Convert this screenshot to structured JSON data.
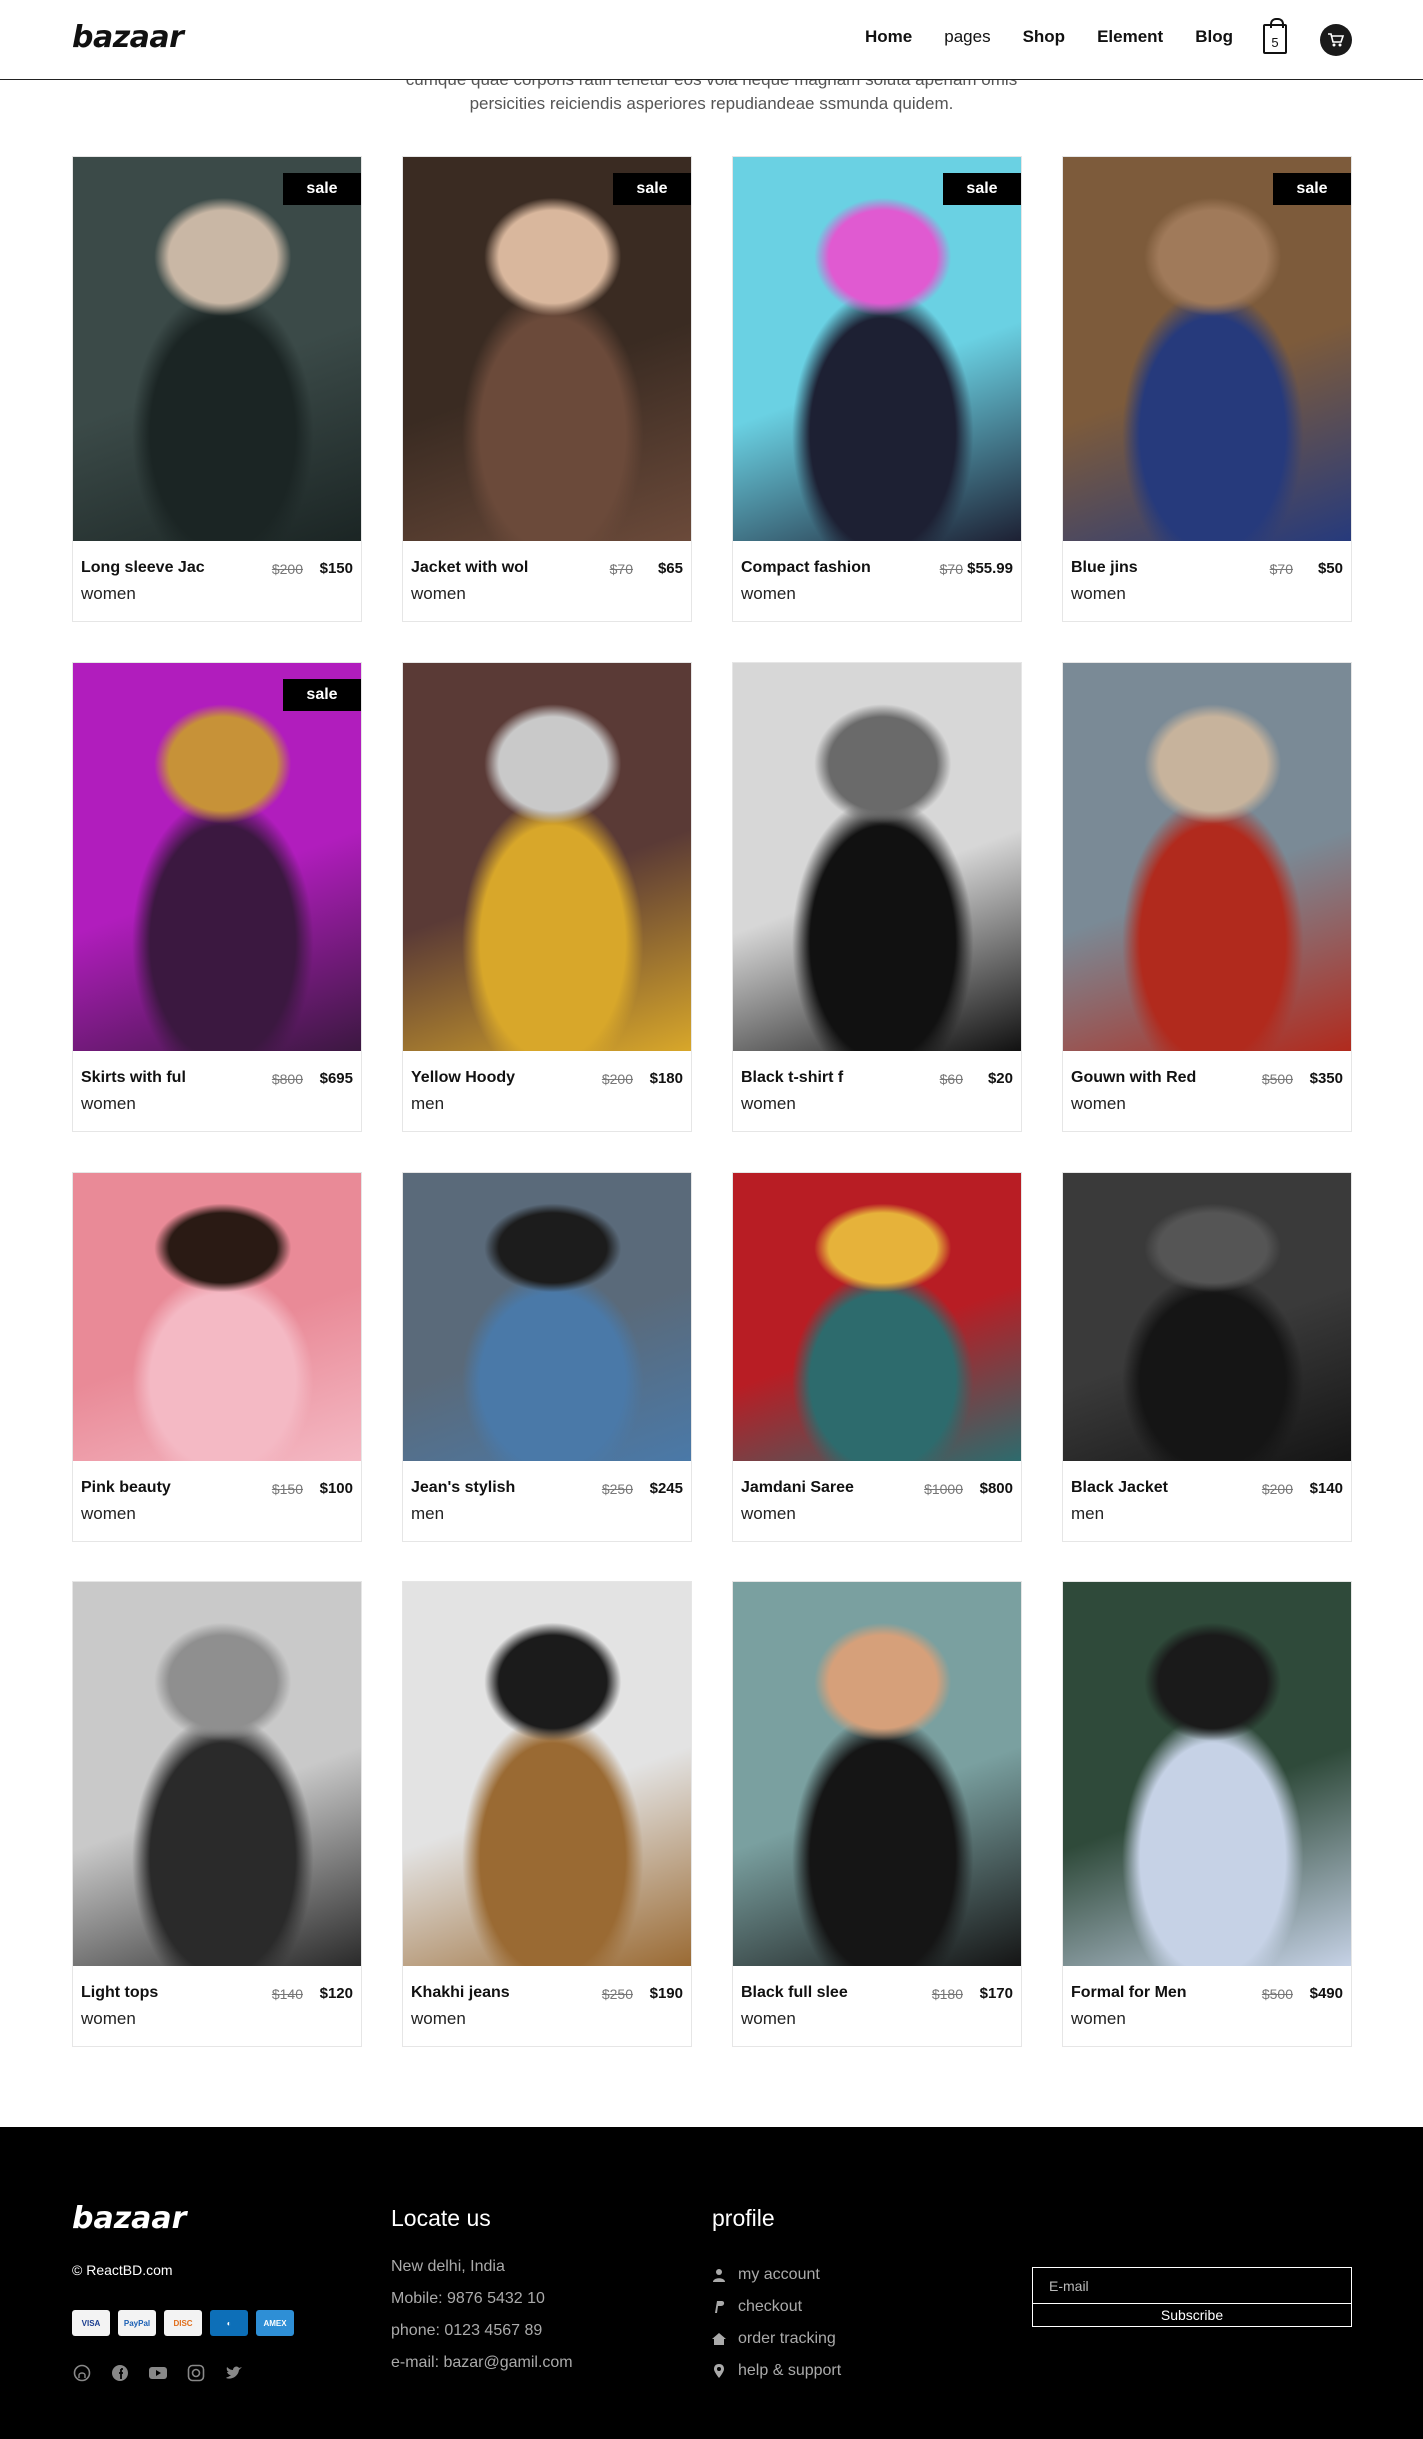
{
  "header": {
    "logo": "bazaar",
    "nav": [
      "Home",
      "pages",
      "Shop",
      "Element",
      "Blog"
    ],
    "bag_count": "5"
  },
  "intro": {
    "line1": "cumque quae corporis ratin tenetur eos vola neque magnam soluta aperiam omis",
    "line2": "persicities reiciendis asperiores repudiandeae ssmunda quidem."
  },
  "products": [
    {
      "name": "Long sleeve Jac",
      "old": "$200",
      "price": "$150",
      "category": "women",
      "sale": "sale",
      "colors": [
        "#3b4a48",
        "#1b2524",
        "#c9b7a5"
      ]
    },
    {
      "name": "Jacket with wol",
      "old": "$70",
      "price": "$65",
      "category": "women",
      "sale": "sale",
      "colors": [
        "#3a2b22",
        "#6b4a3a",
        "#d9b79d"
      ]
    },
    {
      "name": "Compact fashion",
      "old": "$70",
      "price": "$55.99",
      "category": "women",
      "sale": "sale",
      "colors": [
        "#6ad1e3",
        "#1d2033",
        "#e05ad1"
      ]
    },
    {
      "name": "Blue jins",
      "old": "$70",
      "price": "$50",
      "category": "women",
      "sale": "sale",
      "colors": [
        "#7d5b3b",
        "#263a7c",
        "#a07a5a"
      ]
    },
    {
      "name": "Skirts with ful",
      "old": "$800",
      "price": "$695",
      "category": "women",
      "sale": "sale",
      "colors": [
        "#b11dbd",
        "#3b1840",
        "#c79238"
      ]
    },
    {
      "name": "Yellow Hoody",
      "old": "$200",
      "price": "$180",
      "category": "men",
      "sale": "",
      "colors": [
        "#5a3a36",
        "#d8a72a",
        "#c9c9c9"
      ]
    },
    {
      "name": "Black t-shirt f",
      "old": "$60",
      "price": "$20",
      "category": "women",
      "sale": "",
      "colors": [
        "#d7d7d7",
        "#111111",
        "#6a6a6a"
      ]
    },
    {
      "name": "Gouwn with Red",
      "old": "$500",
      "price": "$350",
      "category": "women",
      "sale": "",
      "colors": [
        "#7a8a96",
        "#b12a1d",
        "#c7b39c"
      ]
    },
    {
      "name": "Pink beauty",
      "old": "$150",
      "price": "$100",
      "category": "women",
      "sale": "",
      "colors": [
        "#e98a97",
        "#f4b9c4",
        "#2a1a14"
      ]
    },
    {
      "name": "Jean's stylish",
      "old": "$250",
      "price": "$245",
      "category": "men",
      "sale": "",
      "colors": [
        "#5a6a7a",
        "#4a79a8",
        "#1c1c1c"
      ]
    },
    {
      "name": "Jamdani Saree",
      "old": "$1000",
      "price": "$800",
      "category": "women",
      "sale": "",
      "colors": [
        "#b81d24",
        "#2d6b6d",
        "#e6b23a"
      ]
    },
    {
      "name": "Black Jacket",
      "old": "$200",
      "price": "$140",
      "category": "men",
      "sale": "",
      "colors": [
        "#3a3a3a",
        "#151515",
        "#555555"
      ]
    },
    {
      "name": "Light tops",
      "old": "$140",
      "price": "$120",
      "category": "women",
      "sale": "",
      "colors": [
        "#c9c9c9",
        "#2a2a2a",
        "#8f8f8f"
      ]
    },
    {
      "name": "Khakhi jeans",
      "old": "$250",
      "price": "$190",
      "category": "women",
      "sale": "",
      "colors": [
        "#e3e3e3",
        "#9a6a33",
        "#1b1b1b"
      ]
    },
    {
      "name": "Black full slee",
      "old": "$180",
      "price": "$170",
      "category": "women",
      "sale": "",
      "colors": [
        "#7aa0a0",
        "#151515",
        "#d6a07a"
      ]
    },
    {
      "name": "Formal for Men",
      "old": "$500",
      "price": "$490",
      "category": "women",
      "sale": "",
      "colors": [
        "#2f4a3a",
        "#c6d2e6",
        "#1a1a1a"
      ]
    }
  ],
  "footer": {
    "logo": "bazaar",
    "copyright": "© ReactBD.com",
    "payment_icons": [
      "visa-icon",
      "paypal-icon",
      "discover-icon",
      "diners-icon",
      "amex-icon"
    ],
    "social_icons": [
      "github-icon",
      "facebook-icon",
      "youtube-icon",
      "instagram-icon",
      "twitter-icon"
    ],
    "locate": {
      "title": "Locate us",
      "address": "New delhi, India",
      "mobile": "Mobile: 9876 5432 10",
      "phone": "phone: 0123 4567 89",
      "email": "e-mail: bazar@gamil.com"
    },
    "profile": {
      "title": "profile",
      "items": [
        "my account",
        "checkout",
        "order tracking",
        "help & support"
      ]
    },
    "subscribe": {
      "placeholder": "E-mail",
      "button": "Subscribe"
    }
  }
}
